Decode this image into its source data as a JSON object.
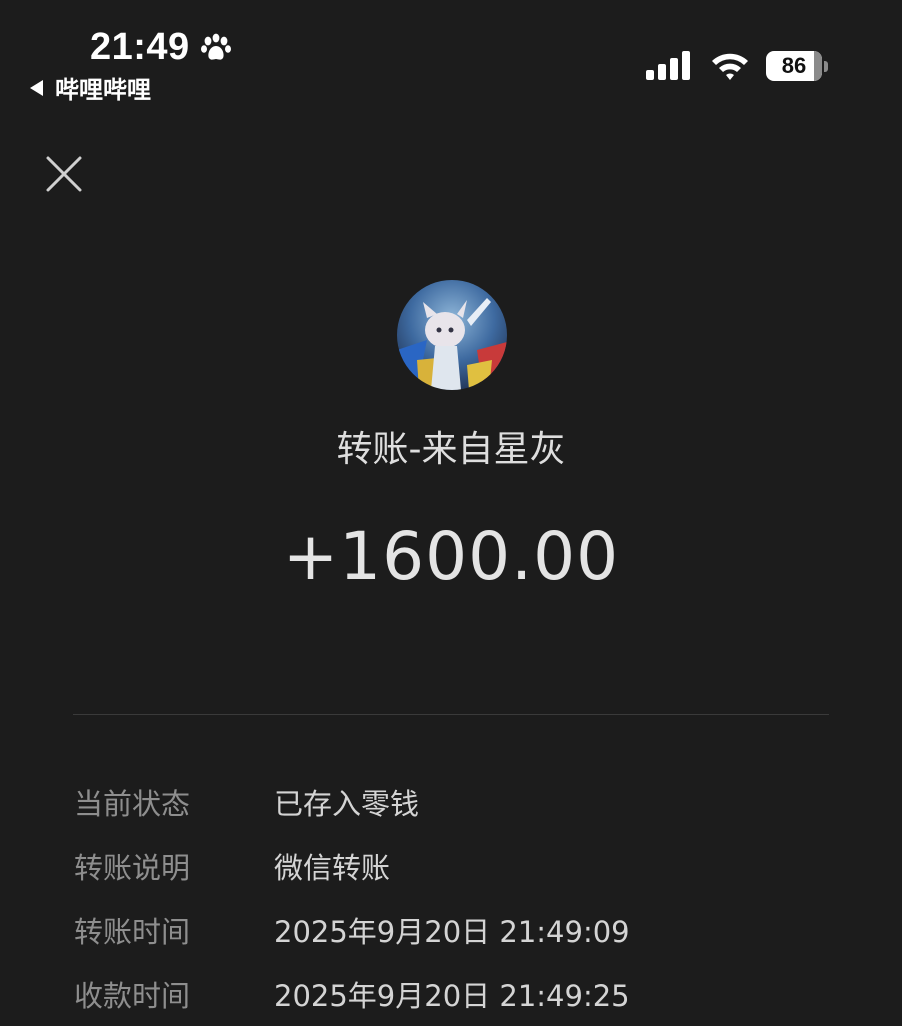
{
  "status_bar": {
    "time": "21:49",
    "back_app": "哔哩哔哩",
    "battery": "86",
    "battery_level_percent": 86,
    "icons": [
      "paw-icon",
      "signal-icon",
      "wifi-icon",
      "battery-icon"
    ]
  },
  "header": {
    "close_icon": "close-icon"
  },
  "transfer": {
    "title": "转账-来自星灰",
    "amount": "+1600.00"
  },
  "details": [
    {
      "label": "当前状态",
      "value": "已存入零钱"
    },
    {
      "label": "转账说明",
      "value": "微信转账"
    },
    {
      "label": "转账时间",
      "value": "2025年9月20日 21:49:09"
    },
    {
      "label": "收款时间",
      "value": "2025年9月20日 21:49:25"
    }
  ],
  "colors": {
    "background": "#1c1c1c",
    "label": "#8e8e8e",
    "value": "#d4d4d4",
    "divider": "#3a3a3a"
  }
}
